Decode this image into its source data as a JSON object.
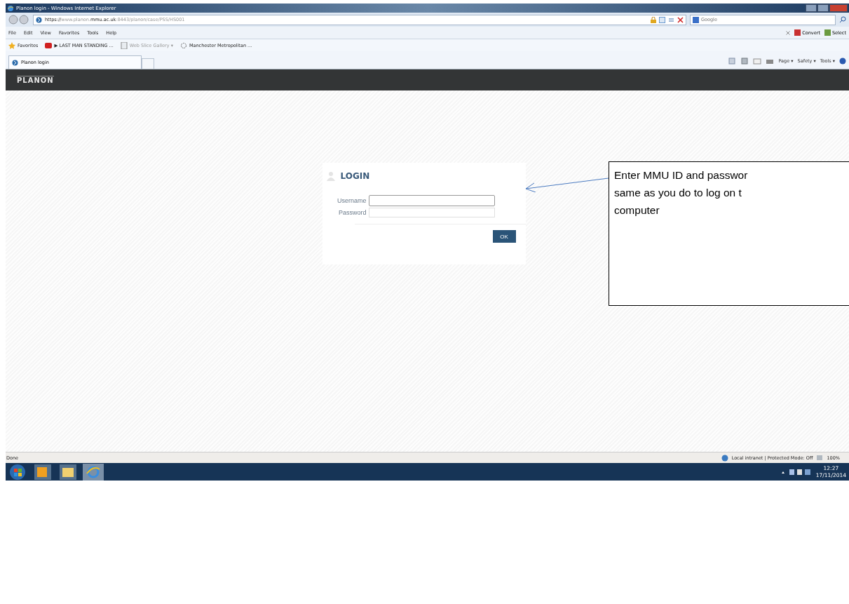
{
  "window": {
    "title": "Planon login - Windows Internet Explorer"
  },
  "address_bar": {
    "url_start": "https://",
    "url_host": "www.planon.",
    "url_domain": "mmu.ac.uk",
    "url_rest": ":8443/planon/case/PSS/HS001"
  },
  "search": {
    "placeholder": "Google"
  },
  "menu": [
    "File",
    "Edit",
    "View",
    "Favorites",
    "Tools",
    "Help"
  ],
  "addons": [
    {
      "label": "Convert"
    },
    {
      "label": "Select"
    }
  ],
  "favorites_bar": [
    {
      "kind": "star",
      "label": "Favorites"
    },
    {
      "kind": "video",
      "label": "▶ LAST MAN STANDING ..."
    },
    {
      "kind": "slice",
      "label": "Web Slice Gallery ▾"
    },
    {
      "kind": "gear",
      "label": "Manchester Metropolitan ..."
    }
  ],
  "tabs": [
    {
      "label": "Planon login",
      "selected": true
    }
  ],
  "command_bar": [
    "Page ▾",
    "Safety ▾",
    "Tools ▾"
  ],
  "app": {
    "logo": "PLANON"
  },
  "login": {
    "title": "LOGIN",
    "fields": [
      {
        "label": "Username",
        "focused": true
      },
      {
        "label": "Password",
        "focused": false
      }
    ],
    "button": "OK"
  },
  "status_bar": {
    "left": "Done",
    "zone": "Local intranet | Protected Mode: Off",
    "zoom": "100%"
  },
  "taskbar": {
    "time": "12:27",
    "date": "17/11/2014"
  },
  "callout": {
    "lines": [
      "Enter MMU ID and passwor",
      "same as you do to log on t",
      "computer"
    ]
  }
}
